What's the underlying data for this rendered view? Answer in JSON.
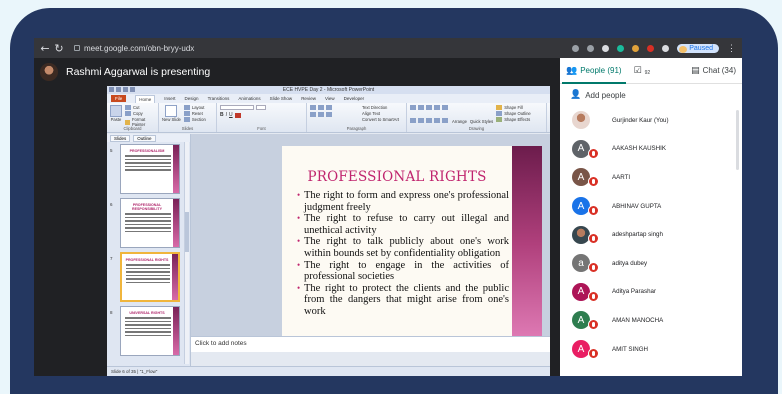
{
  "browser": {
    "url": "meet.google.com/obn-bryy-udx",
    "back_icon": "arrow-left",
    "reload_icon": "reload",
    "profile_status": "Paused"
  },
  "meet": {
    "presenter_text": "Rashmi Aggarwal is presenting",
    "tabs": {
      "people_label": "People (91)",
      "messages_count": "92",
      "chat_label": "Chat (34)"
    },
    "add_people_label": "Add people",
    "participants": [
      {
        "name": "Gurjinder Kaur (You)",
        "initial": "",
        "color": "#e8d6cf",
        "photo": true
      },
      {
        "name": "AAKASH KAUSHIK",
        "initial": "A",
        "color": "#5f6368"
      },
      {
        "name": "AARTI",
        "initial": "A",
        "color": "#795548"
      },
      {
        "name": "ABHINAV GUPTA",
        "initial": "A",
        "color": "#1a73e8"
      },
      {
        "name": "adeshpartap singh",
        "initial": "",
        "color": "#37474f",
        "photo": true
      },
      {
        "name": "aditya dubey",
        "initial": "a",
        "color": "#757575"
      },
      {
        "name": "Aditya Parashar",
        "initial": "A",
        "color": "#ad1457"
      },
      {
        "name": "AMAN MANOCHA",
        "initial": "A",
        "color": "#2e7d4f"
      },
      {
        "name": "AMIT SINGH",
        "initial": "A",
        "color": "#e91e63"
      }
    ]
  },
  "ppt": {
    "window_title": "ECE HVPE Day 2 - Microsoft PowerPoint",
    "tabs": [
      "File",
      "Home",
      "Insert",
      "Design",
      "Transitions",
      "Animations",
      "Slide Show",
      "Review",
      "View",
      "Developer"
    ],
    "groups": [
      "Clipboard",
      "Slides",
      "Font",
      "Paragraph",
      "Drawing"
    ],
    "clipboard_items": [
      "Cut",
      "Copy",
      "Format Painter"
    ],
    "paste_label": "Paste",
    "slides_items": [
      "Layout",
      "Reset",
      "Section"
    ],
    "new_slide_label": "New Slide",
    "paragraph_items": [
      "Text Direction",
      "Align Text",
      "Convert to SmartArt"
    ],
    "drawing_items": [
      "Arrange",
      "Quick Styles",
      "Shape Fill",
      "Shape Outline",
      "Shape Effects"
    ],
    "panel_tabs": [
      "Slides",
      "Outline"
    ],
    "thumbnails": [
      {
        "num": "5",
        "title": "PROFESSIONALISM"
      },
      {
        "num": "6",
        "title": "PROFESSIONAL RESPONSIBILITY"
      },
      {
        "num": "7",
        "title": "PROFESSIONAL RIGHTS"
      },
      {
        "num": "8",
        "title": "UNIVERSAL RIGHTS"
      }
    ],
    "slide_title": "PROFESSIONAL RIGHTS",
    "bullets": [
      "The right to form and express one's professional judgment freely",
      "The right to refuse to carry out illegal and unethical activity",
      "The right to talk publicly about one's work within bounds set by confidentiality obligation",
      "The right to engage in the activities of professional societies",
      "The right to protect the clients and the public from the dangers that might arise from one's work"
    ],
    "notes_placeholder": "Click to add notes",
    "status_text": "Slide 6 of 35 | \"1_Flow\""
  }
}
